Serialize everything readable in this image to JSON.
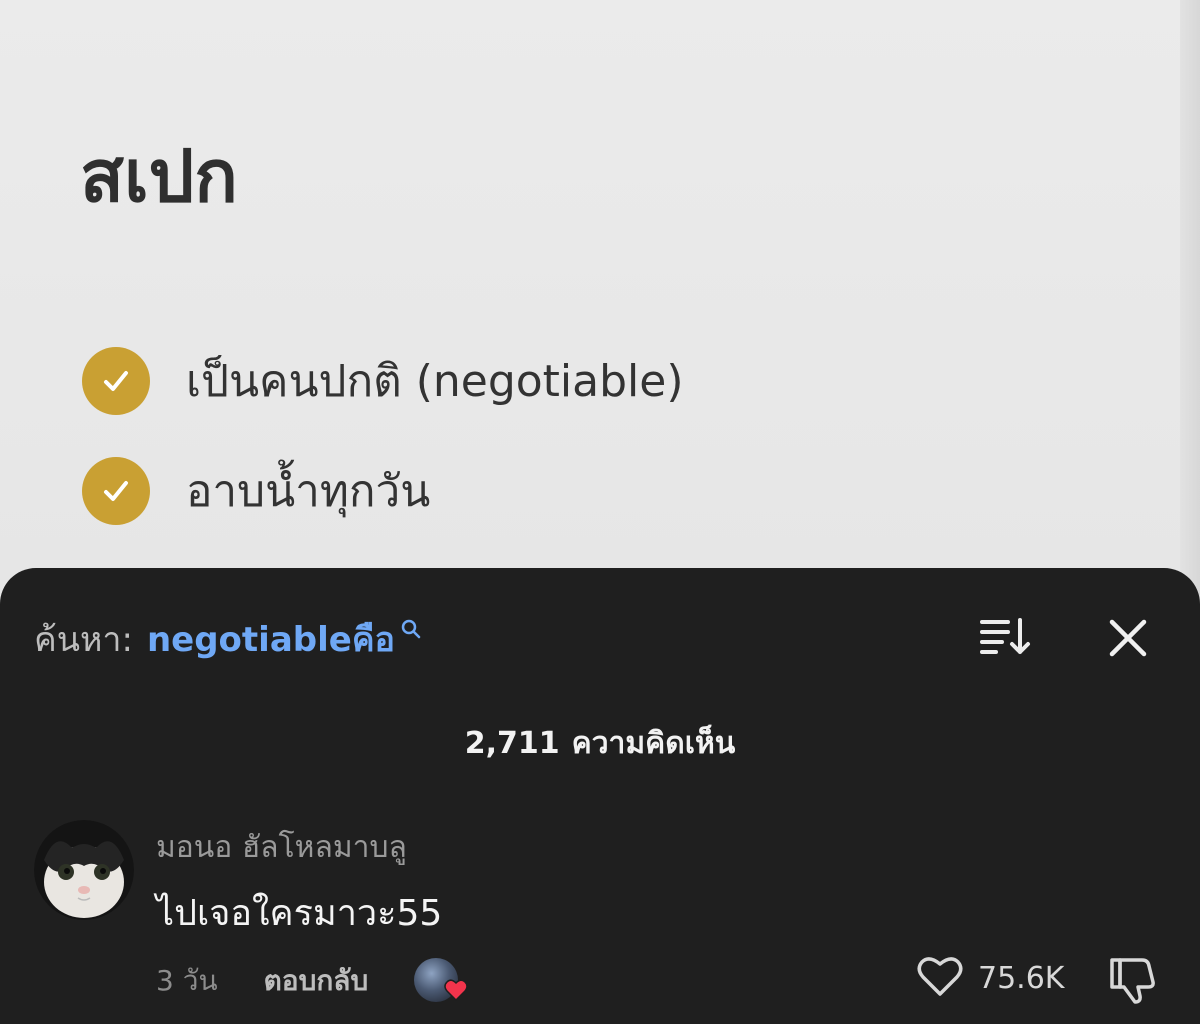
{
  "video": {
    "title": "สเปก",
    "items": [
      "เป็นคนปกติ (negotiable)",
      "อาบน้ำทุกวัน"
    ],
    "check_color": "#c9a033"
  },
  "comments_sheet": {
    "search_prefix": "ค้นหา:",
    "search_term": "negotiableคือ",
    "search_term_color": "#6fa8f5",
    "count_number": "2,711",
    "count_label": "ความคิดเห็น",
    "icons": {
      "sort": "sort-icon",
      "close": "close-icon",
      "search": "search-icon",
      "like": "heart-outline-icon",
      "dislike": "thumbs-down-icon"
    }
  },
  "comment": {
    "username": "มอนอ ฮัลโหลมาบลู",
    "text": "ไปเจอใครมาวะ55",
    "time": "3 วัน",
    "reply_label": "ตอบกลับ",
    "likes": "75.6K",
    "creator_liked": true,
    "avatar_icon": "cat-avatar"
  }
}
